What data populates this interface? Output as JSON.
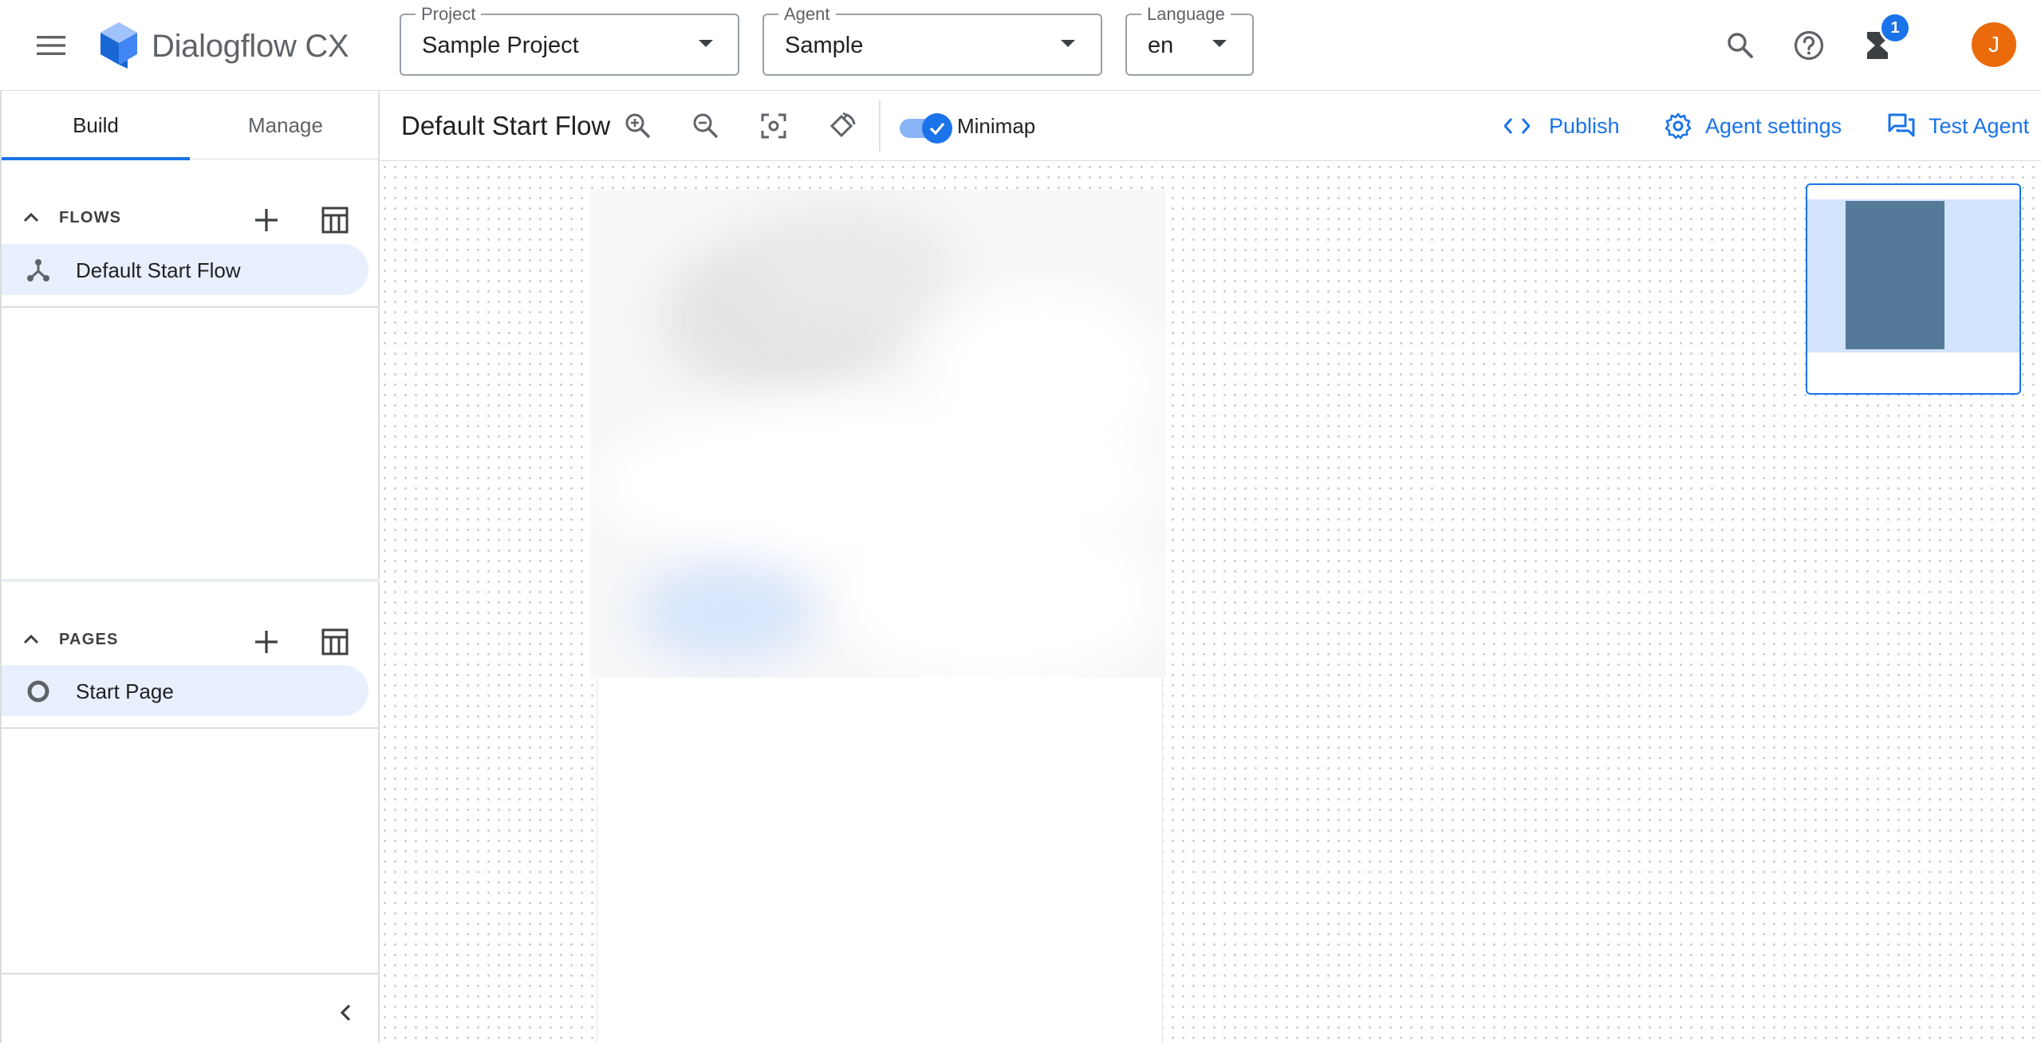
{
  "app": {
    "name": "Dialogflow CX",
    "brand_color": "#1a73e8"
  },
  "header": {
    "project": {
      "label": "Project",
      "value": "Sample Project"
    },
    "agent": {
      "label": "Agent",
      "value": "Sample"
    },
    "language": {
      "label": "Language",
      "value": "en"
    },
    "notifications_count": "1",
    "avatar_initial": "J",
    "avatar_color": "#ea6a0c",
    "icons": [
      "menu-icon",
      "search-icon",
      "help-icon",
      "hourglass-icon"
    ]
  },
  "sidebar": {
    "tabs": [
      {
        "label": "Build",
        "active": true
      },
      {
        "label": "Manage",
        "active": false
      }
    ],
    "flows": {
      "title": "FLOWS",
      "items": [
        {
          "label": "Default Start Flow",
          "icon": "flow-icon",
          "selected": true
        }
      ]
    },
    "pages": {
      "title": "PAGES",
      "items": [
        {
          "label": "Start Page",
          "icon": "circle-icon",
          "selected": true
        }
      ]
    }
  },
  "toolbar": {
    "flow_title": "Default Start Flow",
    "minimap_label": "Minimap",
    "minimap_enabled": true,
    "publish_label": "Publish",
    "agent_settings_label": "Agent settings",
    "test_agent_label": "Test Agent"
  }
}
